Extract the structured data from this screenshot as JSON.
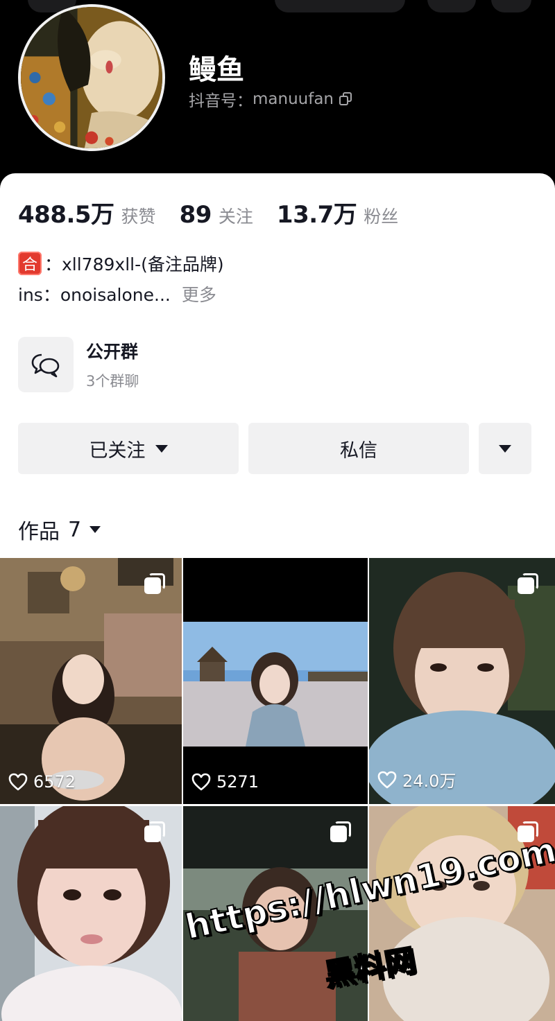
{
  "profile": {
    "nickname": "鳗鱼",
    "id_label": "抖音号：",
    "id_value": "manuufan"
  },
  "stats": [
    {
      "value": "488.5万",
      "label": "获赞"
    },
    {
      "value": "89",
      "label": "关注"
    },
    {
      "value": "13.7万",
      "label": "粉丝"
    }
  ],
  "bio": {
    "badge": "合",
    "line1": "：xll789xll-(备注品牌)",
    "line2": "ins：onoisalone...",
    "more": "更多"
  },
  "group": {
    "title": "公开群",
    "subtitle": "3个群聊"
  },
  "buttons": {
    "follow": "已关注",
    "message": "私信"
  },
  "works_tab": {
    "label": "作品",
    "count": "7"
  },
  "posts": [
    {
      "likes": "6572",
      "multi": true
    },
    {
      "likes": "5271",
      "multi": false
    },
    {
      "likes": "24.0万",
      "multi": true
    },
    {
      "likes": "",
      "multi": true
    },
    {
      "likes": "",
      "multi": true
    },
    {
      "likes": "",
      "multi": true
    }
  ],
  "watermark": {
    "url": "https://hlwn19.com",
    "name": "黑料网"
  },
  "icons": [
    "copy-icon",
    "chat-bubbles-icon",
    "chevron-down-icon",
    "heart-icon",
    "multi-image-icon"
  ],
  "colors": {
    "text": "#161823",
    "secondary": "#8a8b91",
    "button_bg": "#f1f1f2",
    "badge_red": "#e23a2e"
  }
}
